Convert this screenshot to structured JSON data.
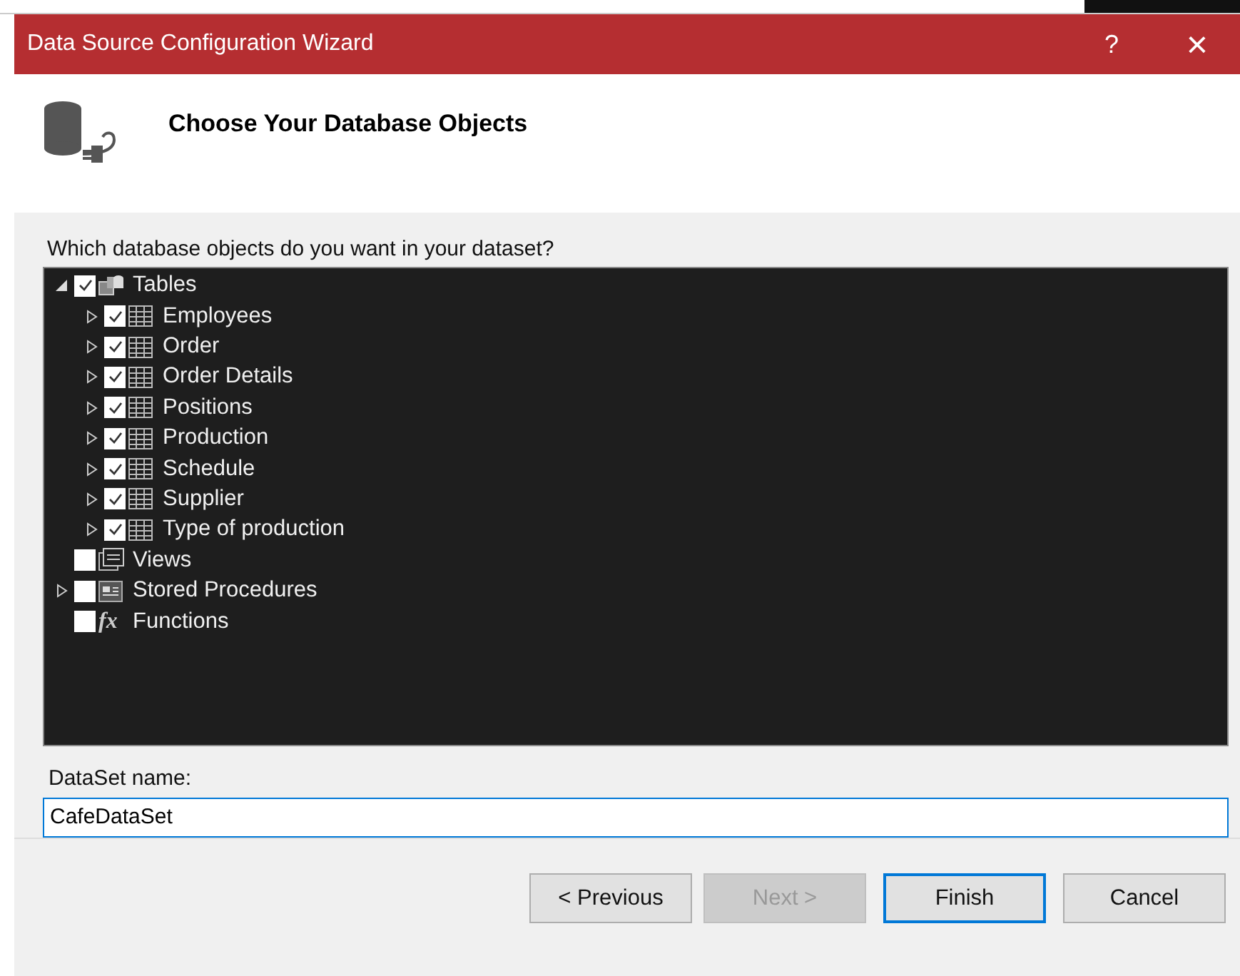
{
  "window": {
    "title": "Data Source Configuration Wizard",
    "help": "?",
    "close": "×"
  },
  "header": {
    "title": "Choose Your Database Objects"
  },
  "prompt": "Which database objects do you want in your dataset?",
  "tree": [
    {
      "label": "Tables",
      "kind": "tables",
      "checked": true,
      "expandable": true,
      "expanded": true,
      "children": [
        {
          "label": "Employees",
          "kind": "table",
          "checked": true,
          "expandable": true,
          "expanded": false
        },
        {
          "label": "Order",
          "kind": "table",
          "checked": true,
          "expandable": true,
          "expanded": false
        },
        {
          "label": "Order Details",
          "kind": "table",
          "checked": true,
          "expandable": true,
          "expanded": false
        },
        {
          "label": "Positions",
          "kind": "table",
          "checked": true,
          "expandable": true,
          "expanded": false
        },
        {
          "label": "Production",
          "kind": "table",
          "checked": true,
          "expandable": true,
          "expanded": false
        },
        {
          "label": "Schedule",
          "kind": "table",
          "checked": true,
          "expandable": true,
          "expanded": false
        },
        {
          "label": "Supplier",
          "kind": "table",
          "checked": true,
          "expandable": true,
          "expanded": false
        },
        {
          "label": "Type of production",
          "kind": "table",
          "checked": true,
          "expandable": true,
          "expanded": false
        }
      ]
    },
    {
      "label": "Views",
      "kind": "views",
      "checked": false,
      "expandable": false
    },
    {
      "label": "Stored Procedures",
      "kind": "procedures",
      "checked": false,
      "expandable": true,
      "expanded": false
    },
    {
      "label": "Functions",
      "kind": "functions",
      "icon_text": "fx",
      "checked": false,
      "expandable": false
    }
  ],
  "dataset": {
    "label": "DataSet name:",
    "value": "CafeDataSet"
  },
  "buttons": [
    {
      "label": "< Previous",
      "disabled": false,
      "default": false
    },
    {
      "label": "Next >",
      "disabled": true,
      "default": false
    },
    {
      "label": "Finish",
      "disabled": false,
      "default": true
    },
    {
      "label": "Cancel",
      "disabled": false,
      "default": false
    }
  ]
}
